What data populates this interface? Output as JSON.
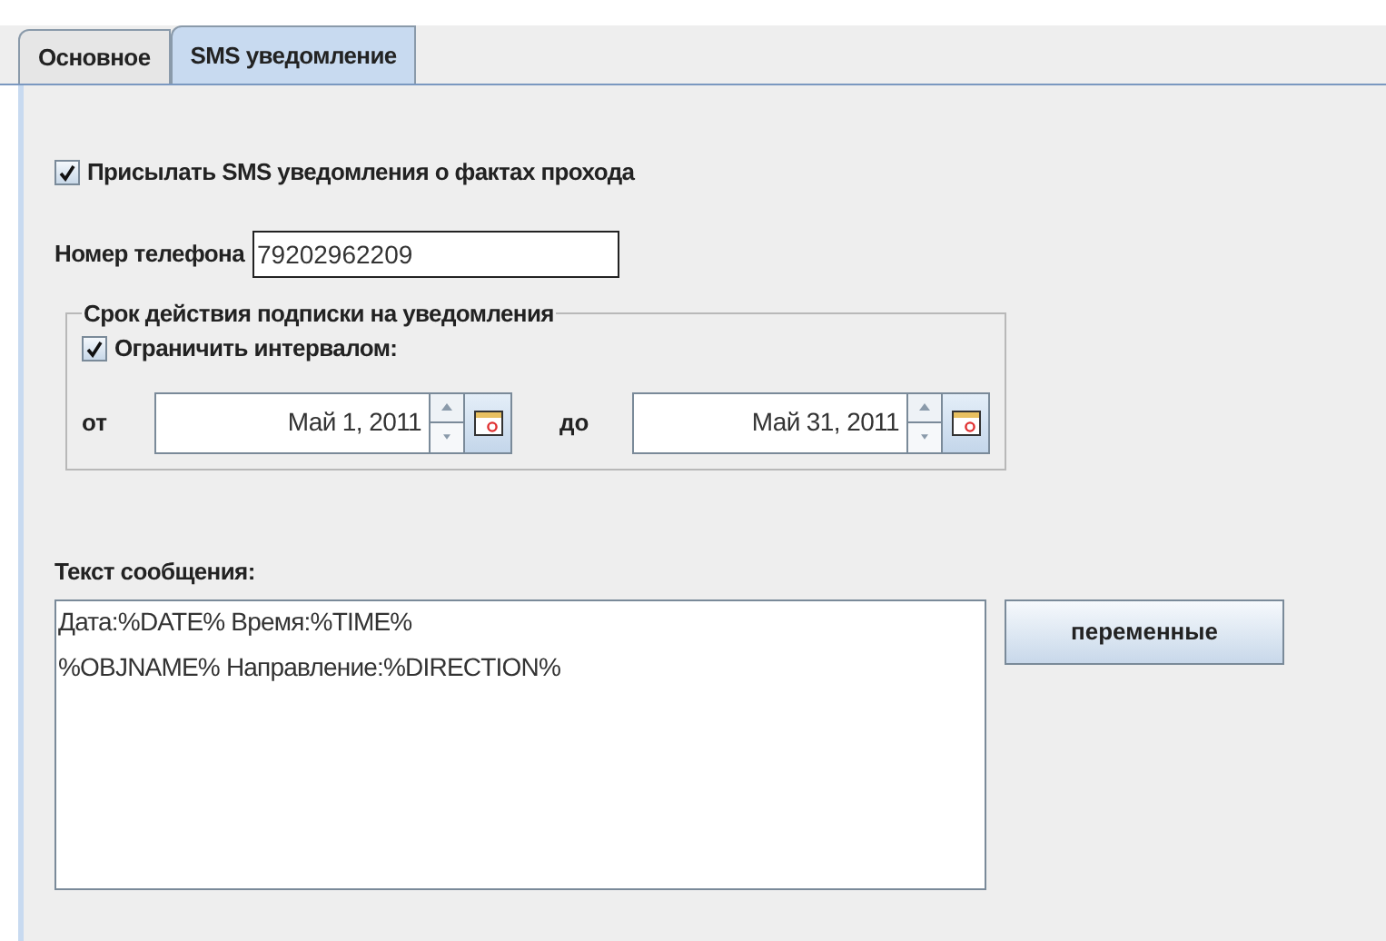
{
  "tabs": [
    {
      "label": "Основное",
      "selected": false
    },
    {
      "label": "SMS уведомление",
      "selected": true
    }
  ],
  "send_sms": {
    "label": "Присылать SMS уведомления о фактах прохода",
    "checked": true
  },
  "phone": {
    "label": "Номер телефона",
    "value": "79202962209"
  },
  "subscription": {
    "title": "Срок действия подписки на уведомления",
    "limit": {
      "label": "Ограничить интервалом:",
      "checked": true
    },
    "from": {
      "label": "от",
      "value": "Май 1, 2011"
    },
    "to": {
      "label": "до",
      "value": "Май 31, 2011"
    }
  },
  "message": {
    "label": "Текст сообщения:",
    "lines": [
      "Дата:%DATE% Время:%TIME%",
      "%OBJNAME% Направление:%DIRECTION%"
    ]
  },
  "variables_button": "переменные"
}
